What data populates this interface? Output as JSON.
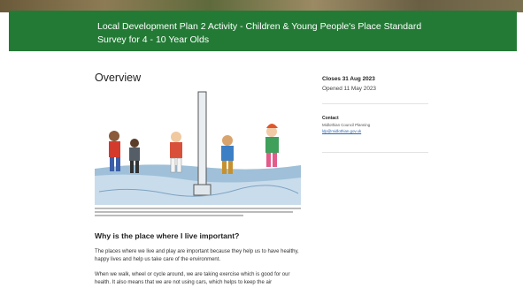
{
  "banner": {
    "title": "Local Development Plan 2 Activity - Children & Young People's Place Standard Survey for 4 - 10 Year Olds"
  },
  "overview": {
    "heading": "Overview"
  },
  "article": {
    "section_heading": "Why is the place where I live important?",
    "paragraph1": "The places where we live and play are important because they help us to have healthy, happy lives and help us take care of the environment.",
    "paragraph2": "When we walk, wheel or cycle around, we are taking exercise which is good for our health. It also means that we are not using cars, which helps to keep the air"
  },
  "sidebar": {
    "closes": "Closes 31 Aug 2023",
    "opened": "Opened 11 May 2023",
    "contact_label": "Contact",
    "contact_org": "Midlothian Council Planning",
    "contact_email": "ldp@midlothian.gov.uk"
  },
  "colors": {
    "banner": "#237a35",
    "link": "#2a66b5"
  },
  "icons": {
    "illustration": "children-street-illustration"
  }
}
